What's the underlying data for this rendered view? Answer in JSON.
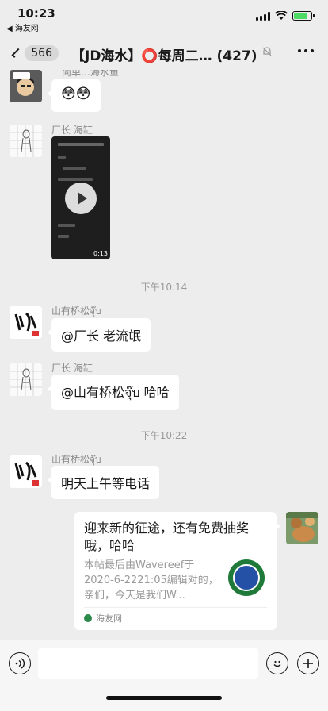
{
  "status_bar": {
    "time": "10:23",
    "back_app": "◀ 海友网"
  },
  "nav": {
    "unread_count": "566",
    "title": "【JD海水】⭕每周二…",
    "member_count": "(427)"
  },
  "messages": {
    "m0": {
      "partial_name": "简单…海水鱼",
      "bubble_text": "😳😳"
    },
    "m1": {
      "sender": "厂长 海缸",
      "video_duration": "0:13"
    },
    "ts1": "下午10:14",
    "m2": {
      "sender": "山有桥松จุ๊บ",
      "text": "@厂长 老流氓"
    },
    "m3": {
      "sender": "厂长 海缸",
      "text": "@山有桥松จุ๊บ 哈哈"
    },
    "ts2": "下午10:22",
    "m4": {
      "sender": "山有桥松จุ๊บ",
      "text": "明天上午等电话"
    },
    "m5": {
      "card_title": "迎来新的征途，还有免费抽奖哦，哈哈",
      "card_desc": "本帖最后由Wavereef于 2020-6-2221:05编辑对的，亲们，今天是我们W...",
      "card_source": "海友网"
    }
  },
  "colors": {
    "background": "#ededed",
    "bubble": "#ffffff",
    "battery": "#4cd964"
  }
}
